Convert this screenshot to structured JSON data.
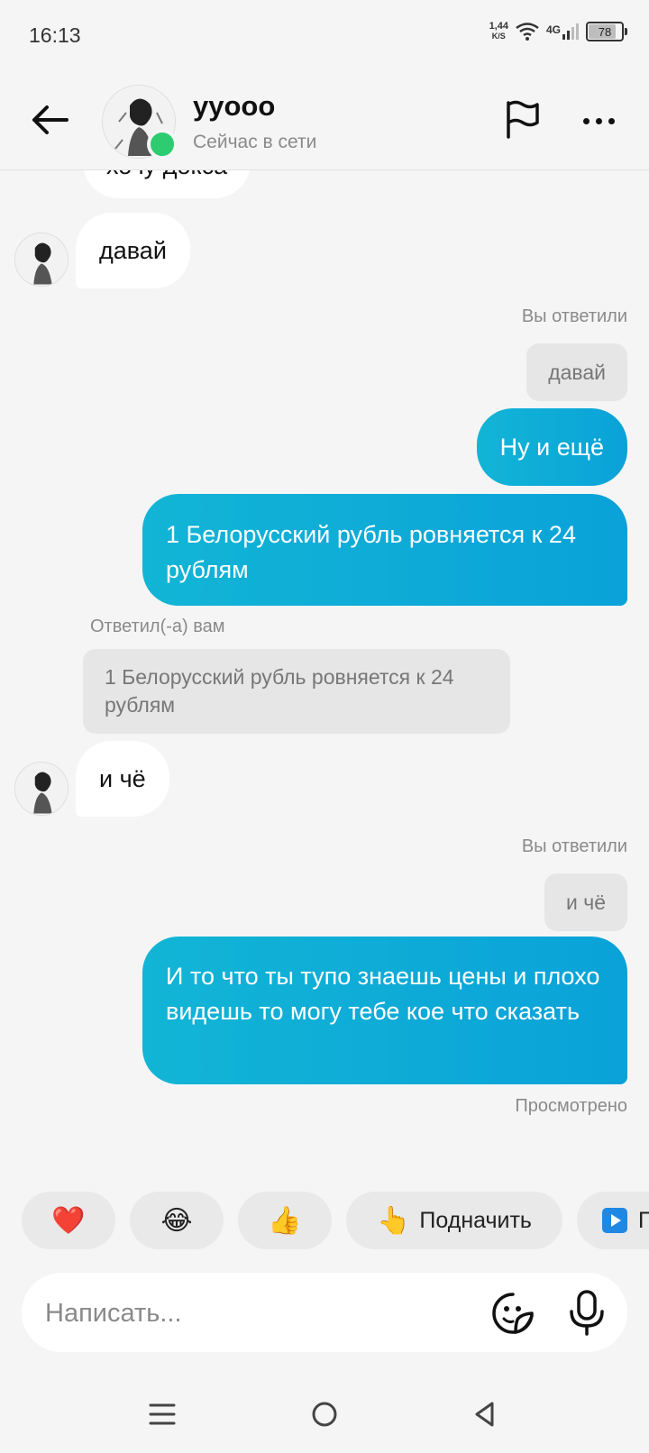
{
  "status_bar": {
    "time": "16:13",
    "speed_value": "1,44",
    "speed_unit": "K/S",
    "network": "4G",
    "battery": "78"
  },
  "header": {
    "contact_name": "yyooo",
    "contact_status": "Сейчас в сети",
    "icons": [
      "back-arrow-icon",
      "flag-icon",
      "more-icon"
    ]
  },
  "messages": {
    "partial_incoming": "хочу доксa",
    "incoming_1": "давай",
    "reply_caption_1": "Вы ответили",
    "reply_quote_1": "давай",
    "outgoing_1": "Ну и ещё",
    "outgoing_2": "1 Белорусский рубль ровняется к 24 рублям",
    "reply_caption_2": "Ответил(-а) вам",
    "reply_quote_2": "1 Белорусский рубль ровняется к 24 рублям",
    "incoming_2": "и чё",
    "reply_caption_3": "Вы ответили",
    "reply_quote_3": "и чё",
    "outgoing_3": "И то что ты тупо знаешь цены и плохо видешь то могу тебе кое что сказать",
    "seen_status": "Просмотрено"
  },
  "quick_reactions": {
    "heart": "❤️",
    "laugh": "😂",
    "thumbs_up": "👍",
    "poke_emoji": "👆",
    "poke_label": "Подначить",
    "video_label": "П"
  },
  "composer": {
    "placeholder": "Написать...",
    "value": ""
  },
  "colors": {
    "outgoing_bubble": "#0aa2d8",
    "online": "#2ecc71",
    "background": "#f5f5f5"
  }
}
